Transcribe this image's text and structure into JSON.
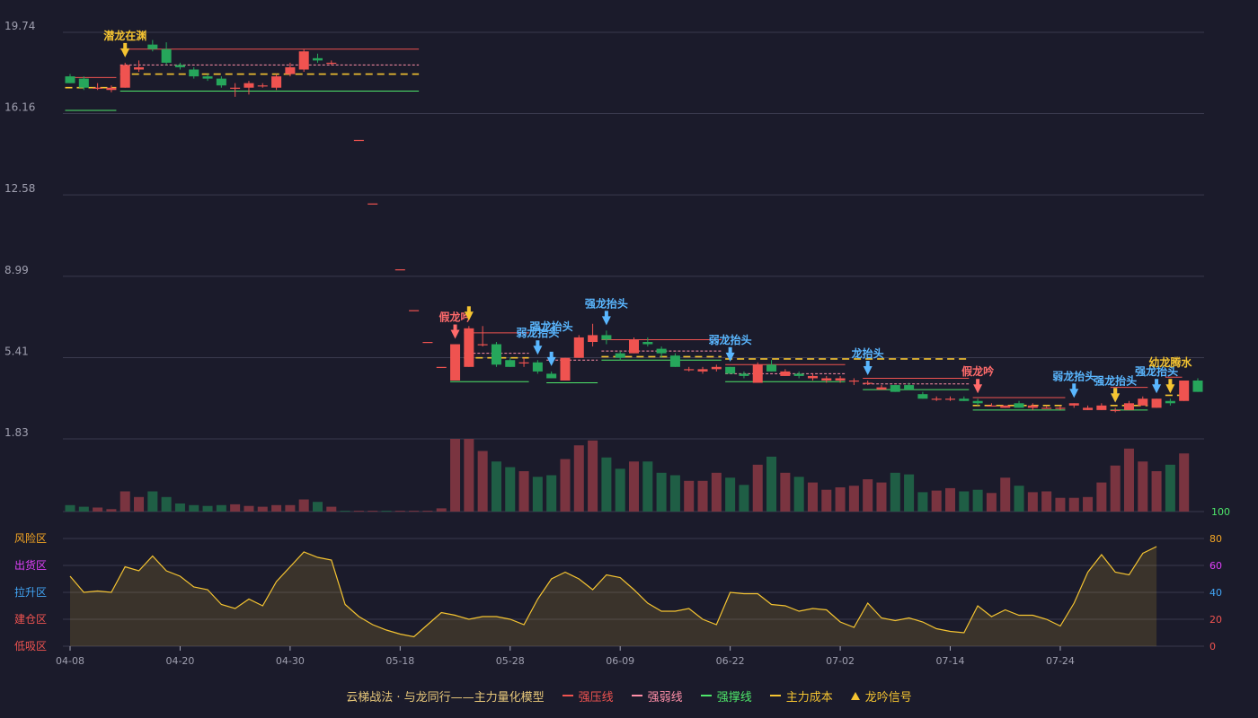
{
  "legend": {
    "title": "云梯战法 · 与龙同行——主力量化模型",
    "items": [
      {
        "label": "强压线",
        "color": "#ef5350",
        "style": "solid"
      },
      {
        "label": "强弱线",
        "color": "#ff8fa8",
        "style": "dash"
      },
      {
        "label": "强撑线",
        "color": "#4ee66a",
        "style": "solid"
      },
      {
        "label": "主力成本",
        "color": "#f5c431",
        "style": "dash"
      },
      {
        "label": "龙吟信号",
        "color": "#f5c431",
        "style": "triangle"
      }
    ]
  },
  "colors": {
    "up": "#ef5350",
    "down": "#26a65b",
    "vol_up": "#7a3440",
    "vol_down": "#1f5e45",
    "grid": "#3a3a4e",
    "axis_text": "#a0a0b0",
    "osc_line": "#f5c431"
  },
  "chart_data": {
    "type": "candlestick",
    "price_axis": {
      "ticks": [
        "19.74",
        "16.16",
        "12.58",
        "8.99",
        "5.41",
        "1.83"
      ],
      "values": [
        19.74,
        16.16,
        12.58,
        8.99,
        5.41,
        1.83
      ]
    },
    "x_ticks": [
      "04-08",
      "04-20",
      "04-30",
      "05-18",
      "05-28",
      "06-09",
      "06-22",
      "07-02",
      "07-14",
      "07-24"
    ],
    "x_tick_index": [
      0,
      8,
      16,
      24,
      32,
      40,
      48,
      56,
      64,
      72
    ],
    "volume_axis": {
      "ticks": [
        "100"
      ]
    },
    "osc_axis": {
      "ticks": [
        "80",
        "60",
        "40",
        "20",
        "0"
      ],
      "values": [
        80,
        60,
        40,
        20,
        0
      ]
    },
    "zones": [
      "风险区",
      "出货区",
      "拉升区",
      "建仓区",
      "低吸区"
    ],
    "zone_colors": [
      "#f5a623",
      "#e040fb",
      "#42a5f5",
      "#ef5350",
      "#ef5350"
    ],
    "osc_tick_colors": [
      "#f5a623",
      "#e040fb",
      "#42a5f5",
      "#ef5350",
      "#ef5350"
    ],
    "candles": [
      [
        17.8,
        17.5,
        17.9,
        17.5
      ],
      [
        17.7,
        17.3,
        17.8,
        17.2
      ],
      [
        17.3,
        17.3,
        17.5,
        17.2
      ],
      [
        17.2,
        17.3,
        17.4,
        17.1
      ],
      [
        17.3,
        18.3,
        18.4,
        17.3
      ],
      [
        18.1,
        18.2,
        18.5,
        18.0
      ],
      [
        19.2,
        19.0,
        19.4,
        18.9
      ],
      [
        19.0,
        18.4,
        19.3,
        18.3
      ],
      [
        18.3,
        18.2,
        18.4,
        18.1
      ],
      [
        18.1,
        17.8,
        18.2,
        17.7
      ],
      [
        17.8,
        17.7,
        17.9,
        17.6
      ],
      [
        17.7,
        17.4,
        17.8,
        17.3
      ],
      [
        17.3,
        17.3,
        17.5,
        16.9
      ],
      [
        17.3,
        17.5,
        17.6,
        17.0
      ],
      [
        17.4,
        17.4,
        17.5,
        17.3
      ],
      [
        17.3,
        17.8,
        17.9,
        17.2
      ],
      [
        17.9,
        18.2,
        18.4,
        17.8
      ],
      [
        18.1,
        18.9,
        19.0,
        18.0
      ],
      [
        18.6,
        18.5,
        18.8,
        18.4
      ],
      [
        18.4,
        18.4,
        18.5,
        18.3
      ],
      [
        null,
        null,
        null,
        null
      ],
      [
        15.0,
        15.0,
        15.0,
        15.0
      ],
      [
        12.2,
        12.2,
        12.2,
        12.2
      ],
      [
        null,
        null,
        null,
        null
      ],
      [
        9.3,
        9.3,
        9.3,
        9.3
      ],
      [
        7.5,
        7.5,
        7.5,
        7.5
      ],
      [
        6.1,
        6.1,
        6.1,
        6.1
      ],
      [
        5.0,
        5.0,
        5.0,
        5.0
      ],
      [
        4.4,
        6.0,
        6.0,
        4.4
      ],
      [
        5.0,
        6.7,
        6.8,
        5.0
      ],
      [
        6.0,
        6.0,
        6.8,
        5.9
      ],
      [
        6.0,
        5.1,
        6.1,
        5.0
      ],
      [
        5.3,
        5.0,
        5.4,
        5.0
      ],
      [
        5.2,
        5.2,
        5.4,
        5.0
      ],
      [
        5.2,
        4.8,
        5.3,
        4.7
      ],
      [
        4.7,
        4.5,
        4.8,
        4.5
      ],
      [
        4.4,
        5.4,
        5.4,
        4.4
      ],
      [
        5.4,
        6.3,
        6.4,
        5.4
      ],
      [
        6.1,
        6.4,
        6.9,
        5.9
      ],
      [
        6.4,
        6.2,
        6.6,
        6.0
      ],
      [
        5.6,
        5.4,
        5.7,
        5.3
      ],
      [
        5.6,
        6.2,
        6.3,
        5.6
      ],
      [
        6.1,
        6.0,
        6.3,
        5.9
      ],
      [
        5.8,
        5.6,
        5.9,
        5.4
      ],
      [
        5.5,
        5.0,
        5.6,
        5.0
      ],
      [
        4.9,
        4.9,
        5.0,
        4.8
      ],
      [
        4.8,
        4.9,
        5.0,
        4.7
      ],
      [
        4.9,
        5.0,
        5.1,
        4.8
      ],
      [
        5.0,
        4.7,
        5.0,
        4.7
      ],
      [
        4.7,
        4.6,
        4.8,
        4.5
      ],
      [
        4.3,
        5.1,
        5.2,
        4.3
      ],
      [
        5.1,
        4.8,
        5.3,
        4.8
      ],
      [
        4.6,
        4.8,
        4.9,
        4.6
      ],
      [
        4.7,
        4.6,
        4.8,
        4.5
      ],
      [
        4.5,
        4.6,
        4.7,
        4.4
      ],
      [
        4.4,
        4.5,
        4.6,
        4.3
      ],
      [
        4.4,
        4.5,
        4.6,
        4.3
      ],
      [
        4.4,
        4.4,
        4.5,
        4.2
      ],
      [
        4.3,
        4.3,
        4.4,
        4.2
      ],
      [
        4.0,
        4.1,
        4.2,
        4.0
      ],
      [
        4.2,
        3.9,
        4.2,
        3.9
      ],
      [
        4.2,
        4.0,
        4.3,
        4.0
      ],
      [
        3.8,
        3.6,
        3.9,
        3.6
      ],
      [
        3.6,
        3.6,
        3.7,
        3.5
      ],
      [
        3.6,
        3.6,
        3.7,
        3.5
      ],
      [
        3.6,
        3.5,
        3.7,
        3.5
      ],
      [
        3.5,
        3.4,
        3.6,
        3.3
      ],
      [
        3.3,
        3.3,
        3.4,
        3.3
      ],
      [
        3.2,
        3.3,
        3.3,
        3.2
      ],
      [
        3.4,
        3.2,
        3.5,
        3.2
      ],
      [
        3.2,
        3.3,
        3.4,
        3.1
      ],
      [
        3.2,
        3.2,
        3.3,
        3.2
      ],
      [
        3.2,
        3.2,
        3.3,
        3.1
      ],
      [
        3.3,
        3.4,
        3.4,
        3.2
      ],
      [
        3.1,
        3.2,
        3.3,
        3.1
      ],
      [
        3.1,
        3.3,
        3.4,
        3.1
      ],
      [
        3.1,
        3.1,
        3.2,
        3.0
      ],
      [
        3.1,
        3.4,
        3.5,
        3.1
      ],
      [
        3.3,
        3.6,
        3.7,
        3.3
      ],
      [
        3.2,
        3.6,
        3.6,
        3.2
      ],
      [
        3.5,
        3.4,
        3.6,
        3.3
      ],
      [
        3.5,
        4.4,
        4.4,
        3.5
      ],
      [
        4.4,
        3.9,
        4.5,
        3.9
      ]
    ],
    "volume": [
      8,
      6,
      5,
      3,
      25,
      18,
      25,
      18,
      10,
      8,
      7,
      8,
      9,
      7,
      6,
      8,
      8,
      15,
      12,
      6,
      1,
      1,
      1,
      1,
      1,
      1,
      1,
      4,
      90,
      90,
      75,
      62,
      55,
      50,
      43,
      45,
      65,
      82,
      88,
      67,
      53,
      62,
      62,
      48,
      45,
      38,
      38,
      48,
      42,
      33,
      58,
      68,
      48,
      43,
      36,
      27,
      30,
      32,
      40,
      36,
      48,
      46,
      24,
      26,
      29,
      25,
      27,
      23,
      42,
      32,
      24,
      25,
      17,
      17,
      18,
      36,
      57,
      78,
      62,
      50,
      58,
      72
    ],
    "osc": [
      52,
      40,
      41,
      40,
      59,
      56,
      67,
      56,
      52,
      44,
      42,
      31,
      28,
      35,
      30,
      48,
      59,
      70,
      66,
      64,
      31,
      22,
      16,
      12,
      9,
      7,
      16,
      25,
      23,
      20,
      22,
      22,
      20,
      16,
      35,
      50,
      55,
      50,
      42,
      53,
      51,
      42,
      32,
      26,
      26,
      28,
      20,
      16,
      40,
      39,
      39,
      31,
      30,
      26,
      28,
      27,
      18,
      14,
      32,
      21,
      19,
      21,
      18,
      13,
      11,
      10,
      30,
      22,
      27,
      23,
      23,
      20,
      15,
      32,
      55,
      68,
      55,
      53,
      69,
      74
    ],
    "lines": [
      {
        "kind": "resist",
        "x0": 0,
        "x1": 3,
        "y": 17.75
      },
      {
        "kind": "support",
        "x0": 0,
        "x1": 3,
        "y": 16.3
      },
      {
        "kind": "cost",
        "x0": 0,
        "x1": 3,
        "y": 17.3
      },
      {
        "kind": "resist",
        "x0": 4,
        "x1": 25,
        "y": 19.0
      },
      {
        "kind": "weak",
        "x0": 4,
        "x1": 25,
        "y": 18.3
      },
      {
        "kind": "cost",
        "x0": 4,
        "x1": 25,
        "y": 17.9
      },
      {
        "kind": "support",
        "x0": 4,
        "x1": 25,
        "y": 17.15
      },
      {
        "kind": "resist",
        "x0": 29,
        "x1": 33,
        "y": 6.5
      },
      {
        "kind": "weak",
        "x0": 29,
        "x1": 33,
        "y": 5.6
      },
      {
        "kind": "cost",
        "x0": 29,
        "x1": 33,
        "y": 5.4
      },
      {
        "kind": "support",
        "x0": 28,
        "x1": 33,
        "y": 4.35
      },
      {
        "kind": "weak",
        "x0": 35,
        "x1": 38,
        "y": 5.3
      },
      {
        "kind": "support",
        "x0": 35,
        "x1": 38,
        "y": 4.3
      },
      {
        "kind": "resist",
        "x0": 39,
        "x1": 47,
        "y": 6.2
      },
      {
        "kind": "weak",
        "x0": 39,
        "x1": 47,
        "y": 5.7
      },
      {
        "kind": "cost",
        "x0": 39,
        "x1": 47,
        "y": 5.45
      },
      {
        "kind": "support",
        "x0": 39,
        "x1": 47,
        "y": 5.3
      },
      {
        "kind": "resist",
        "x0": 48,
        "x1": 56,
        "y": 5.1
      },
      {
        "kind": "weak",
        "x0": 48,
        "x1": 56,
        "y": 4.7
      },
      {
        "kind": "cost",
        "x0": 48,
        "x1": 65,
        "y": 5.35
      },
      {
        "kind": "support",
        "x0": 48,
        "x1": 56,
        "y": 4.35
      },
      {
        "kind": "resist",
        "x0": 58,
        "x1": 65,
        "y": 4.5
      },
      {
        "kind": "weak",
        "x0": 58,
        "x1": 65,
        "y": 4.25
      },
      {
        "kind": "support",
        "x0": 58,
        "x1": 65,
        "y": 4.0
      },
      {
        "kind": "resist",
        "x0": 66,
        "x1": 72,
        "y": 3.65
      },
      {
        "kind": "cost",
        "x0": 66,
        "x1": 72,
        "y": 3.3
      },
      {
        "kind": "support",
        "x0": 66,
        "x1": 72,
        "y": 3.1
      },
      {
        "kind": "resist",
        "x0": 76,
        "x1": 78,
        "y": 4.1
      },
      {
        "kind": "cost",
        "x0": 76,
        "x1": 78,
        "y": 3.3
      },
      {
        "kind": "support",
        "x0": 76,
        "x1": 78,
        "y": 3.1
      },
      {
        "kind": "resist",
        "x0": 80,
        "x1": 80.5,
        "y": 4.55
      },
      {
        "kind": "cost",
        "x0": 80,
        "x1": 80.5,
        "y": 3.75
      }
    ],
    "signals": [
      {
        "i": 4,
        "text": "潜龙在渊",
        "color": "#f5c431",
        "at": "high",
        "offset": 0
      },
      {
        "i": 28,
        "text": "假龙吟",
        "color": "#ff6b6b",
        "at": "high",
        "offset": 0
      },
      {
        "i": 29,
        "text": "",
        "color": "#f5c431",
        "at": "high",
        "offset": 0
      },
      {
        "i": 34,
        "text": "弱龙抬头",
        "color": "#5ab7ff",
        "at": "high",
        "offset": 0
      },
      {
        "i": 35,
        "text": "强龙抬头",
        "color": "#5ab7ff",
        "at": "high",
        "offset": 20
      },
      {
        "i": 39,
        "text": "强龙抬头",
        "color": "#5ab7ff",
        "at": "high",
        "offset": 0
      },
      {
        "i": 48,
        "text": "弱龙抬头",
        "color": "#5ab7ff",
        "at": "high",
        "offset": 0
      },
      {
        "i": 58,
        "text": "龙抬头",
        "color": "#5ab7ff",
        "at": "high",
        "offset": 0
      },
      {
        "i": 66,
        "text": "假龙吟",
        "color": "#ff6b6b",
        "at": "high",
        "offset": 0
      },
      {
        "i": 73,
        "text": "弱龙抬头",
        "color": "#5ab7ff",
        "at": "high",
        "offset": 0
      },
      {
        "i": 76,
        "text": "强龙抬头",
        "color": "#5ab7ff",
        "at": "high",
        "offset": 0
      },
      {
        "i": 76,
        "text": "",
        "color": "#f5c431",
        "at": "high",
        "offset": 0
      },
      {
        "i": 79,
        "text": "强龙抬头",
        "color": "#5ab7ff",
        "at": "high",
        "offset": 0
      },
      {
        "i": 80,
        "text": "幼龙腾水",
        "color": "#f5c431",
        "at": "high",
        "offset": 10
      }
    ]
  }
}
